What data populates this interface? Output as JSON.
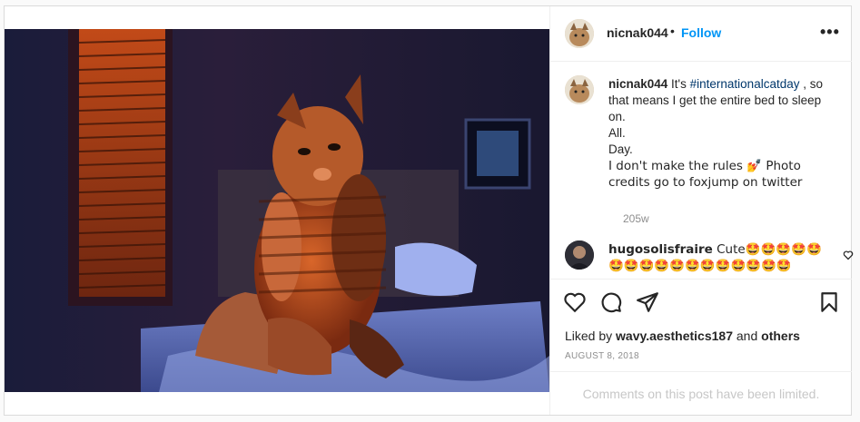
{
  "post": {
    "username": "nicnak044",
    "follow_label": "Follow",
    "separator": "•",
    "more_label": "•••",
    "caption": {
      "username": "nicnak044",
      "text_before": " It's ",
      "hashtag": "#internationalcatday",
      "lines": [
        " , so that means I get the entire bed to sleep on.",
        "All.",
        "Day.",
        "I don't make the rules 💅 Photo credits go to foxjump on twitter"
      ]
    },
    "caption_time": "205w",
    "comment": {
      "username": "hugosolisfraire",
      "text": " Cute🤩🤩🤩🤩🤩🤩🤩🤩🤩🤩🤩🤩🤩🤩🤩🤩🤩"
    },
    "likes": {
      "prefix": "Liked by ",
      "user": "wavy.aesthetics187",
      "middle": " and ",
      "others": "others"
    },
    "date": "August 8, 2018",
    "comments_limited": "Comments on this post have been limited."
  },
  "icons": {
    "like": "heart-icon",
    "comment": "comment-icon",
    "share": "paper-plane-icon",
    "save": "bookmark-icon",
    "more": "more-options-icon",
    "comment_like": "heart-small-icon"
  },
  "colors": {
    "link": "#0095f6",
    "hashtag": "#00376b",
    "muted": "#8e8e8e",
    "limited_text": "#c7c7c7"
  }
}
